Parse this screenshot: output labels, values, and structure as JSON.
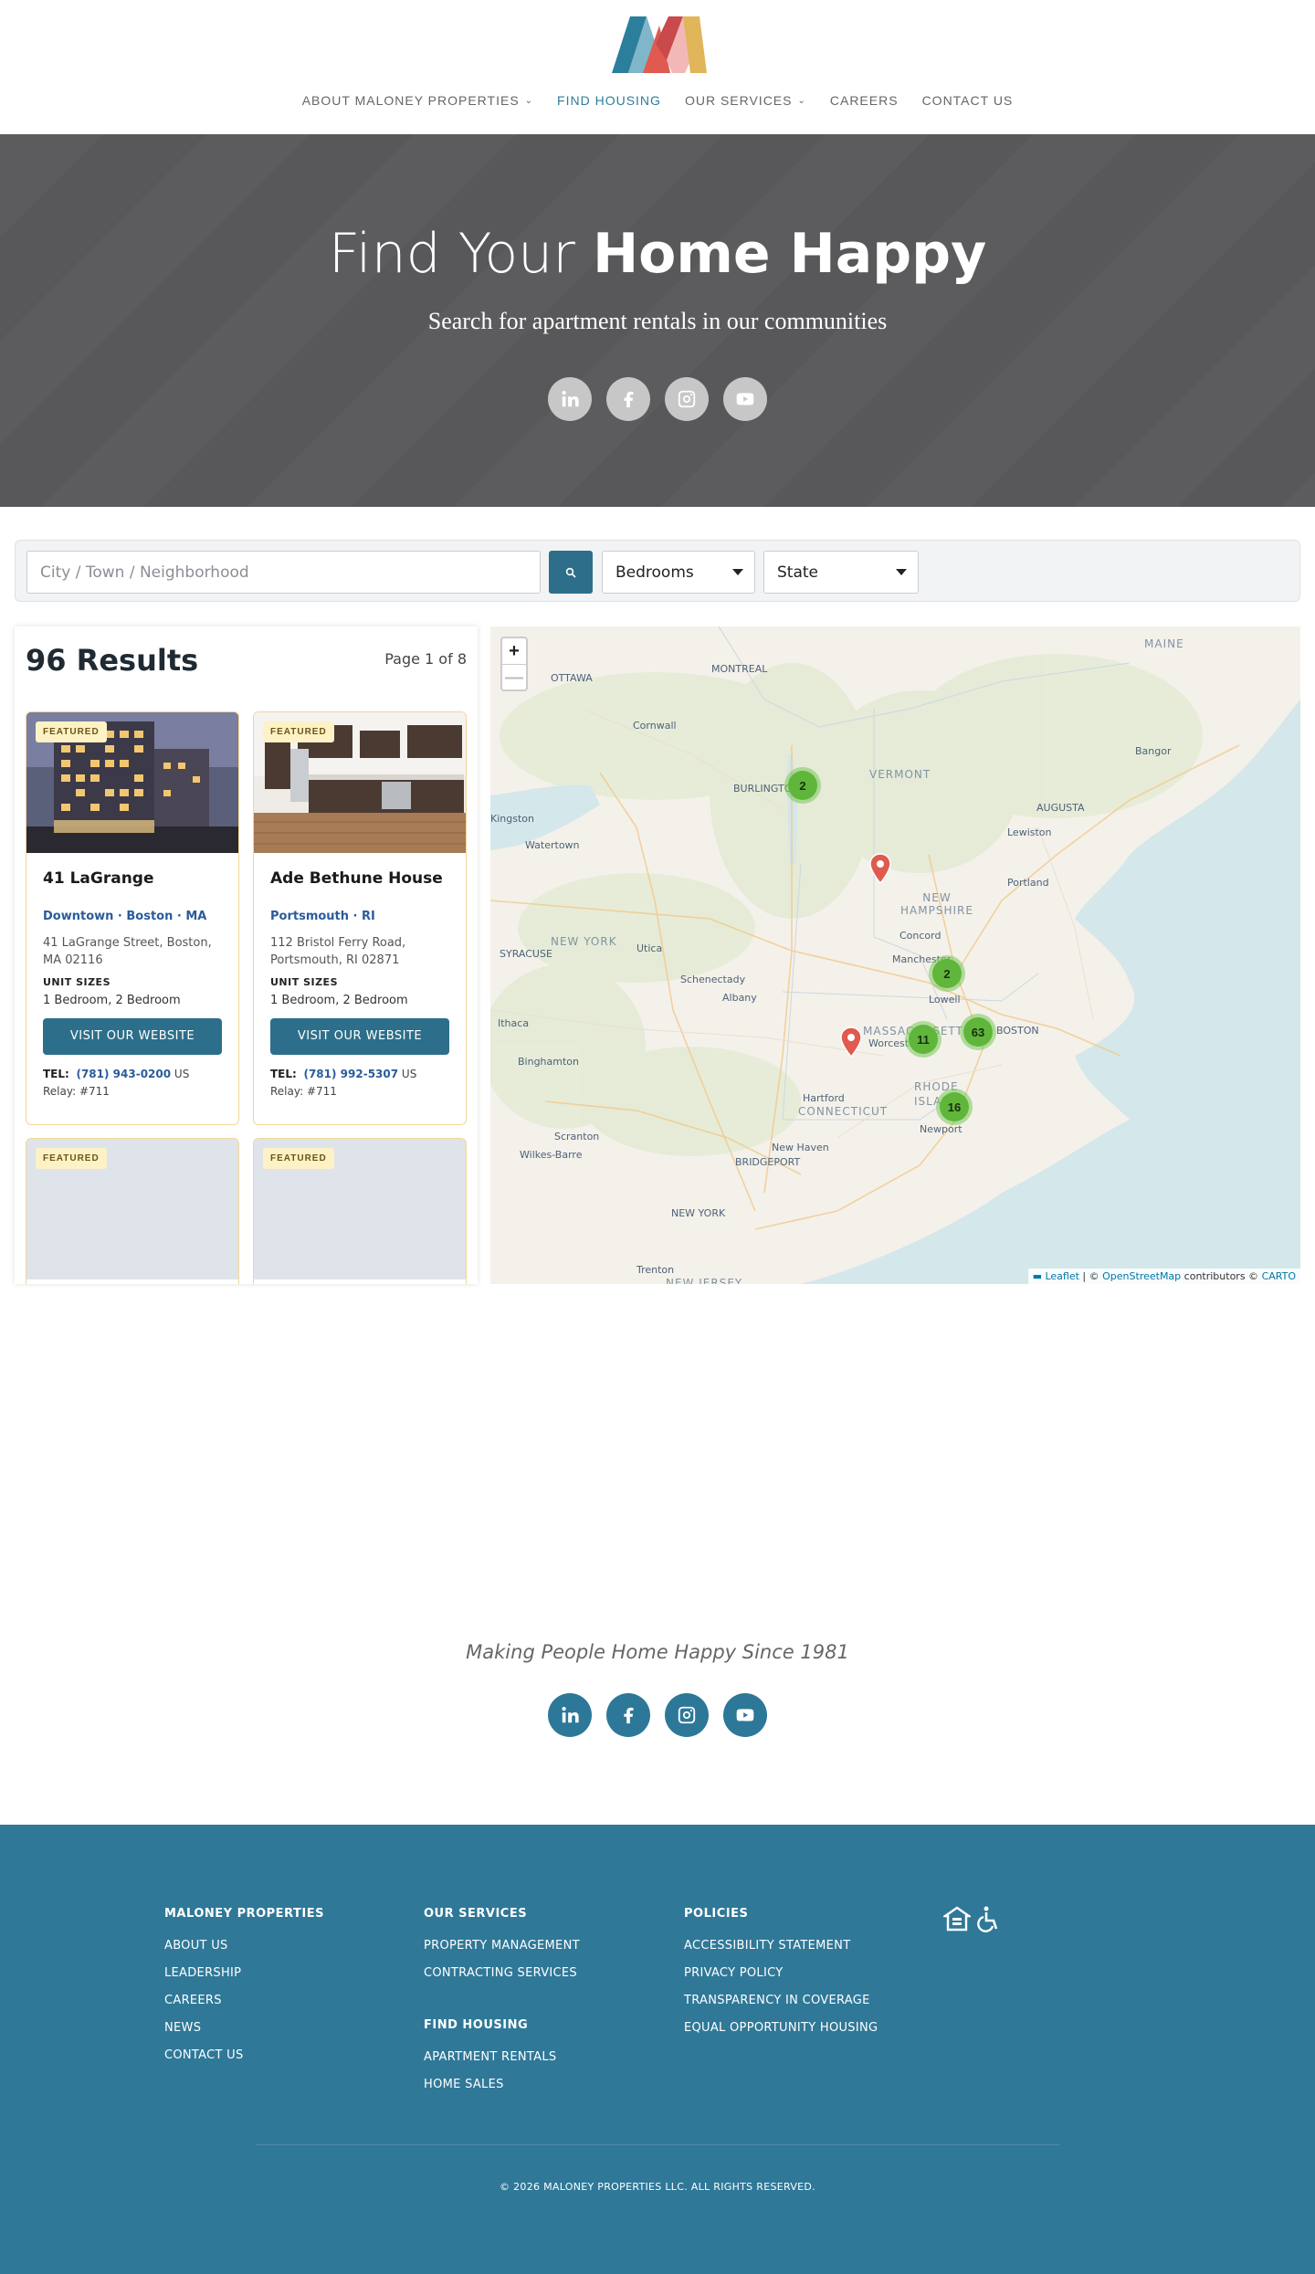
{
  "nav": {
    "items": [
      {
        "label": "ABOUT MALONEY PROPERTIES",
        "dropdown": true
      },
      {
        "label": "FIND HOUSING",
        "dropdown": false,
        "active": true
      },
      {
        "label": "OUR SERVICES",
        "dropdown": true
      },
      {
        "label": "CAREERS",
        "dropdown": false
      },
      {
        "label": "CONTACT US",
        "dropdown": false
      }
    ]
  },
  "hero": {
    "title_light": "Find Your",
    "title_bold": "Home Happy",
    "subtitle": "Search for apartment rentals in our communities",
    "social": [
      "linkedin-icon",
      "facebook-icon",
      "instagram-icon",
      "youtube-icon"
    ]
  },
  "search": {
    "placeholder": "City / Town / Neighborhood",
    "bedrooms_label": "Bedrooms",
    "state_label": "State"
  },
  "results": {
    "count": "96 Results",
    "page": "Page 1 of 8",
    "cards": [
      {
        "badge": "FEATURED",
        "title": "41 LaGrange",
        "location": "Downtown · Boston · MA",
        "address": "41 LaGrange Street, Boston, MA 02116",
        "unit_heading": "UNIT SIZES",
        "units": "1 Bedroom, 2 Bedroom",
        "button": "VISIT OUR WEBSITE",
        "tel_label": "TEL:",
        "phone": "(781) 943-0200",
        "relay": "US Relay: #711"
      },
      {
        "badge": "FEATURED",
        "title": "Ade Bethune House",
        "location": "Portsmouth · RI",
        "address": "112 Bristol Ferry Road, Portsmouth, RI 02871",
        "unit_heading": "UNIT SIZES",
        "units": "1 Bedroom, 2 Bedroom",
        "button": "VISIT OUR WEBSITE",
        "tel_label": "TEL:",
        "phone": "(781) 992-5307",
        "relay": "US Relay: #711"
      },
      {
        "badge": "FEATURED"
      },
      {
        "badge": "FEATURED"
      }
    ]
  },
  "map": {
    "zoom_in": "+",
    "zoom_out": "—",
    "clusters": [
      "2",
      "2",
      "11",
      "63",
      "16"
    ],
    "labels": {
      "maine": "MAINE",
      "ottawa": "OTTAWA",
      "montreal": "MONTREAL",
      "cornwall": "Cornwall",
      "kingston": "Kingston",
      "bangor": "Bangor",
      "vermont": "VERMONT",
      "burlington": "BURLINGTON",
      "augusta": "AUGUSTA",
      "lewiston": "Lewiston",
      "watertown": "Watertown",
      "portland": "Portland",
      "new_hampshire": "NEW HAMPSHIRE",
      "concord": "Concord",
      "new_york_state": "NEW YORK",
      "syracuse": "SYRACUSE",
      "utica": "Utica",
      "schenectady": "Schenectady",
      "albany": "Albany",
      "manchester": "Manchester",
      "lowell": "Lowell",
      "ithaca": "Ithaca",
      "massachusetts": "MASSACHUSETTS",
      "worcester": "Worcester",
      "boston": "BOSTON",
      "binghamton": "Binghamton",
      "hartford": "Hartford",
      "connecticut": "CONNECTICUT",
      "rhode_island": "RHODE ISLAND",
      "newport": "Newport",
      "scranton": "Scranton",
      "wilkes_barre": "Wilkes-Barre",
      "new_haven": "New Haven",
      "bridgeport": "BRIDGEPORT",
      "new_york_city": "NEW YORK",
      "trenton": "Trenton",
      "new_jersey": "NEW JERSEY"
    },
    "attribution": {
      "leaflet": "Leaflet",
      "sep1": " | © ",
      "osm": "OpenStreetMap",
      "mid": " contributors © ",
      "carto": "CARTO"
    }
  },
  "tagline": {
    "text": "Making People Home Happy Since 1981"
  },
  "footer": {
    "col1": {
      "heading": "MALONEY PROPERTIES",
      "links": [
        "ABOUT US",
        "LEADERSHIP",
        "CAREERS",
        "NEWS",
        "CONTACT US"
      ]
    },
    "col2": {
      "heading": "OUR SERVICES",
      "links": [
        "PROPERTY MANAGEMENT",
        "CONTRACTING SERVICES"
      ],
      "heading2": "FIND HOUSING",
      "links2": [
        "APARTMENT RENTALS",
        "HOME SALES"
      ]
    },
    "col3": {
      "heading": "POLICIES",
      "links": [
        "ACCESSIBILITY STATEMENT",
        "PRIVACY POLICY",
        "TRANSPARENCY IN COVERAGE",
        "EQUAL OPPORTUNITY HOUSING"
      ]
    },
    "copyright": "© 2026 MALONEY PROPERTIES LLC. ALL RIGHTS RESERVED."
  },
  "colors": {
    "brand": "#2d7899",
    "button": "#2d6f8a",
    "hero_bg": "#59595b",
    "cluster": "#5fb63a",
    "pin": "#e05a4f",
    "featured_bg": "#fdf2c6"
  }
}
